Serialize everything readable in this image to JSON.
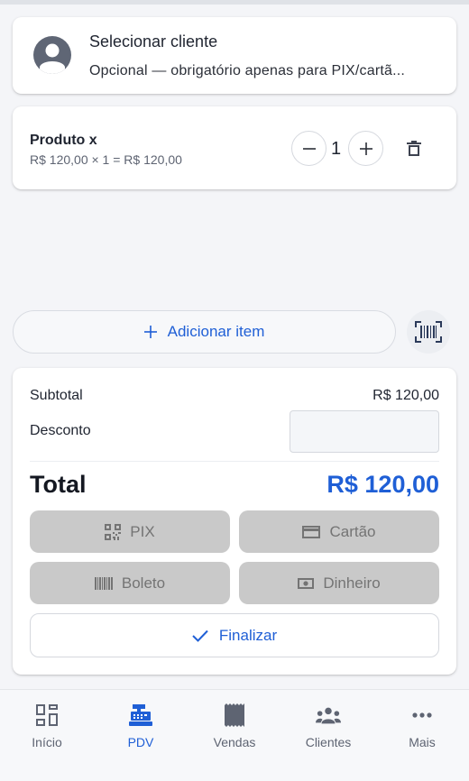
{
  "client": {
    "title": "Selecionar cliente",
    "subtitle": "Opcional — obrigatório apenas para PIX/cartã..."
  },
  "cart": {
    "items": [
      {
        "name": "Produto x",
        "detail": "R$ 120,00 × 1 = R$ 120,00",
        "quantity": "1"
      }
    ]
  },
  "actions": {
    "add_item_label": "Adicionar item",
    "scan_icon": "barcode-scan-icon"
  },
  "summary": {
    "subtotal_label": "Subtotal",
    "subtotal_value": "R$ 120,00",
    "discount_label": "Desconto",
    "discount_value": "",
    "total_label": "Total",
    "total_value": "R$ 120,00"
  },
  "payment": {
    "pix_label": "PIX",
    "cartao_label": "Cartão",
    "boleto_label": "Boleto",
    "dinheiro_label": "Dinheiro",
    "finalizar_label": "Finalizar"
  },
  "nav": {
    "items": [
      {
        "label": "Início",
        "icon": "dashboard-icon",
        "active": false
      },
      {
        "label": "PDV",
        "icon": "cash-register-icon",
        "active": true
      },
      {
        "label": "Vendas",
        "icon": "receipt-icon",
        "active": false
      },
      {
        "label": "Clientes",
        "icon": "group-icon",
        "active": false
      },
      {
        "label": "Mais",
        "icon": "more-horizontal-icon",
        "active": false
      }
    ]
  },
  "colors": {
    "accent": "#1f5fd6",
    "disabled_button": "#c9c9c9",
    "background": "#f4f5f8"
  }
}
